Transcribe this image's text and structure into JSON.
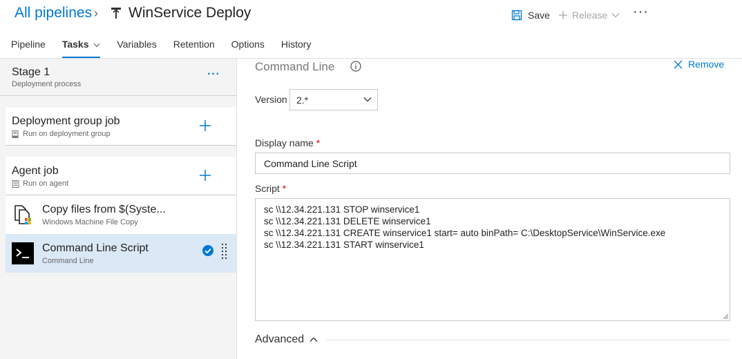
{
  "header": {
    "breadcrumb_root": "All pipelines",
    "pipeline_name": "WinService Deploy",
    "save_label": "Save",
    "release_label": "Release",
    "more_label": "···"
  },
  "tabs": [
    {
      "label": "Pipeline"
    },
    {
      "label": "Tasks",
      "active": true
    },
    {
      "label": "Variables"
    },
    {
      "label": "Retention"
    },
    {
      "label": "Options"
    },
    {
      "label": "History"
    }
  ],
  "stage": {
    "title": "Stage 1",
    "subtitle": "Deployment process",
    "more_label": "···"
  },
  "jobs": [
    {
      "title": "Deployment group job",
      "subtitle": "Run on deployment group"
    },
    {
      "title": "Agent job",
      "subtitle": "Run on agent"
    }
  ],
  "tasks": [
    {
      "title": "Copy files from $(Syste...",
      "subtitle": "Windows Machine File Copy",
      "icon": "file-copy-icon"
    },
    {
      "title": "Command Line Script",
      "subtitle": "Command Line",
      "icon": "terminal-icon",
      "selected": true
    }
  ],
  "task_details": {
    "title": "Command Line",
    "remove_label": "Remove",
    "version_label": "Version",
    "version_value": "2.*",
    "display_name_label": "Display name",
    "display_name_value": "Command Line Script",
    "script_label": "Script",
    "required_mark": "*",
    "script_lines": [
      "sc \\\\12.34.221.131 STOP winservice1",
      "sc \\\\12.34.221.131 DELETE winservice1",
      "sc \\\\12.34.221.131 CREATE winservice1 start= auto binPath= C:\\DesktopService\\WinService.exe",
      "sc \\\\12.34.221.131 START winservice1"
    ],
    "advanced_label": "Advanced"
  },
  "colors": {
    "accent": "#0078d4",
    "selected_row": "#dbe8f5",
    "left_panel_bg": "#f4f4f4",
    "required": "#dd0000"
  }
}
